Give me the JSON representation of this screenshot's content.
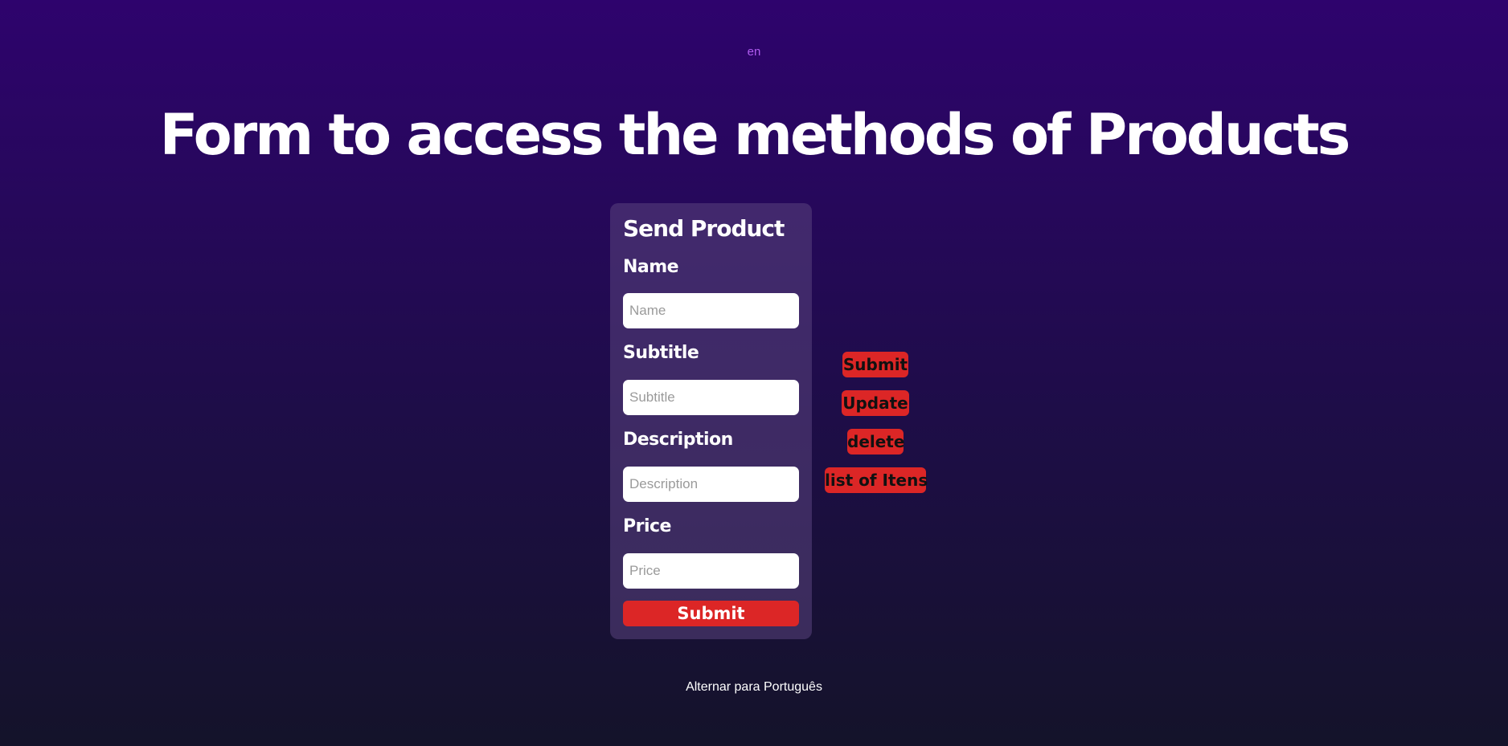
{
  "language_indicator": "en",
  "page_title": "Form to access the methods of Products",
  "form": {
    "title": "Send Product",
    "fields": [
      {
        "label": "Name",
        "placeholder": "Name",
        "value": ""
      },
      {
        "label": "Subtitle",
        "placeholder": "Subtitle",
        "value": ""
      },
      {
        "label": "Description",
        "placeholder": "Description",
        "value": ""
      },
      {
        "label": "Price",
        "placeholder": "Price",
        "value": ""
      }
    ],
    "submit_label": "Submit"
  },
  "actions": [
    {
      "label": "Submit"
    },
    {
      "label": "Update"
    },
    {
      "label": "delete"
    },
    {
      "label": "list of Itens"
    }
  ],
  "footer": {
    "toggle_language_label": "Alternar para Português"
  },
  "colors": {
    "background_top": "#2e036d",
    "background_bottom": "#14132a",
    "button_red": "#dc2626",
    "language_indicator": "#b05cf0"
  }
}
